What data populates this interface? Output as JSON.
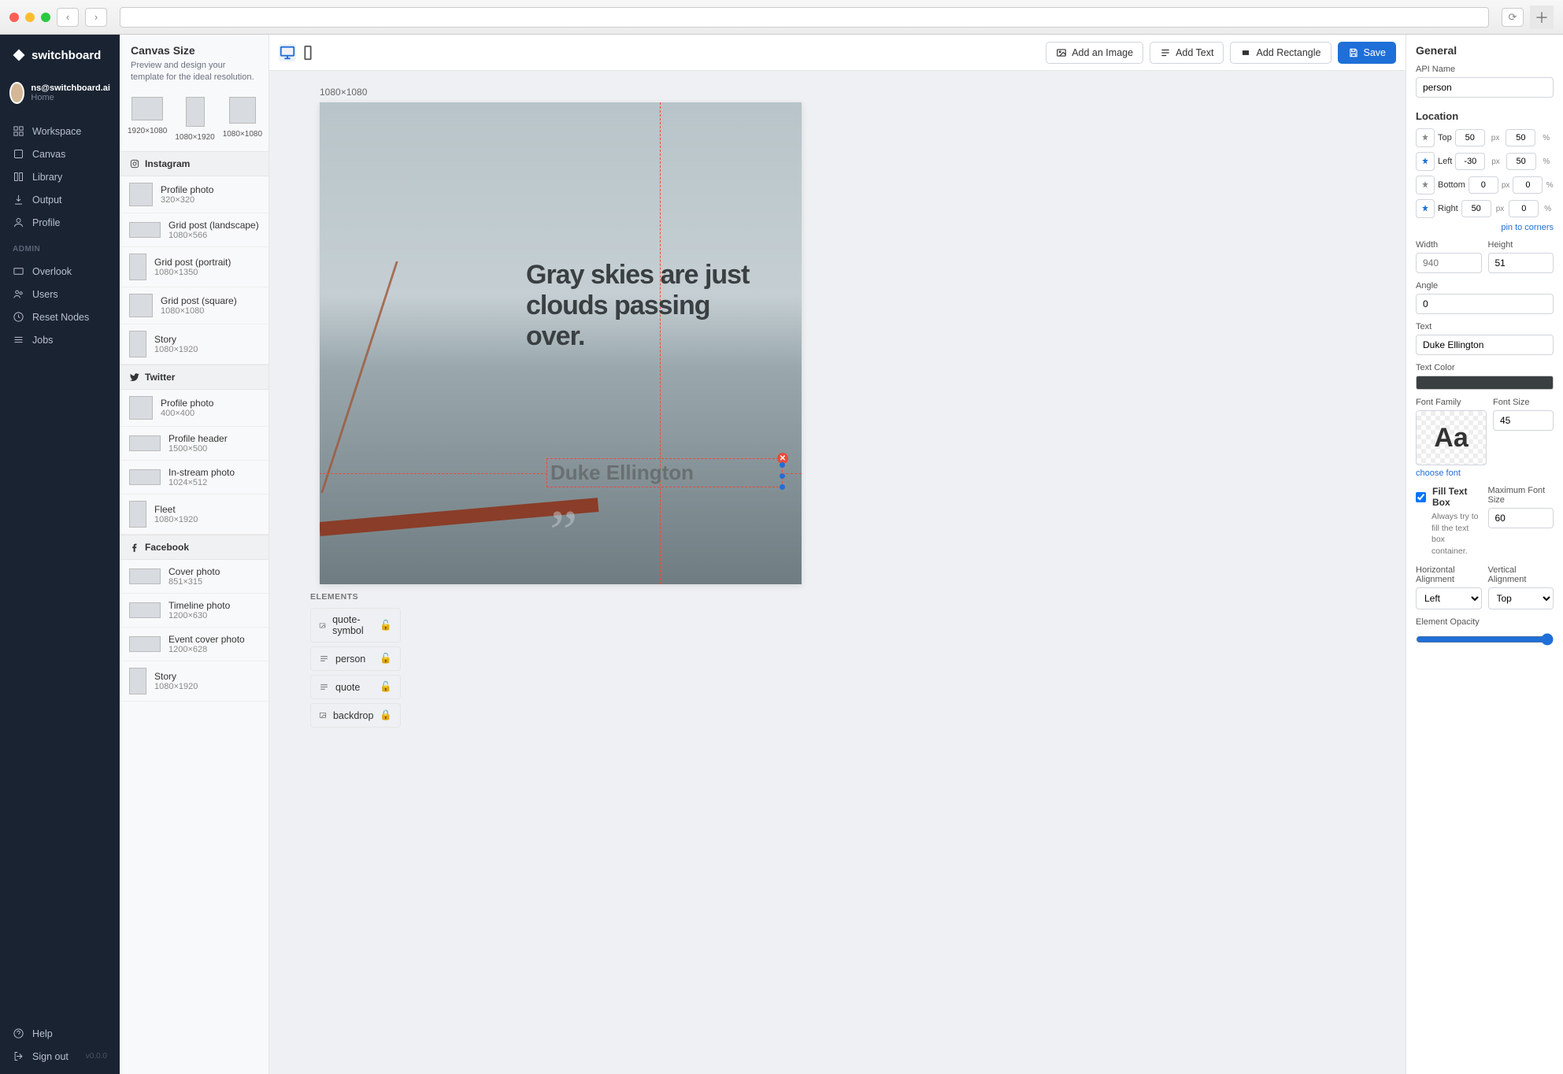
{
  "brand": "switchboard",
  "user": {
    "email": "ns@switchboard.ai",
    "home": "Home"
  },
  "nav_main": [
    {
      "label": "Workspace"
    },
    {
      "label": "Canvas"
    },
    {
      "label": "Library"
    },
    {
      "label": "Output"
    },
    {
      "label": "Profile"
    }
  ],
  "nav_admin_label": "ADMIN",
  "nav_admin": [
    {
      "label": "Overlook"
    },
    {
      "label": "Users"
    },
    {
      "label": "Reset Nodes"
    },
    {
      "label": "Jobs"
    }
  ],
  "nav_bottom": {
    "help": "Help",
    "signout": "Sign out",
    "version": "v0.0.0"
  },
  "sizepanel": {
    "title": "Canvas Size",
    "desc": "Preview and design your template for the ideal resolution.",
    "presets": [
      {
        "label": "1920×1080"
      },
      {
        "label": "1080×1920"
      },
      {
        "label": "1080×1080"
      }
    ],
    "sections": [
      {
        "name": "Instagram",
        "icon": "instagram",
        "items": [
          {
            "name": "Profile photo",
            "dim": "320×320",
            "shape": "sq"
          },
          {
            "name": "Grid post (landscape)",
            "dim": "1080×566",
            "shape": "wide"
          },
          {
            "name": "Grid post (portrait)",
            "dim": "1080×1350",
            "shape": "tall"
          },
          {
            "name": "Grid post (square)",
            "dim": "1080×1080",
            "shape": "sq"
          },
          {
            "name": "Story",
            "dim": "1080×1920",
            "shape": "tall"
          }
        ]
      },
      {
        "name": "Twitter",
        "icon": "twitter",
        "items": [
          {
            "name": "Profile photo",
            "dim": "400×400",
            "shape": "sq"
          },
          {
            "name": "Profile header",
            "dim": "1500×500",
            "shape": "wide"
          },
          {
            "name": "In-stream photo",
            "dim": "1024×512",
            "shape": "wide"
          },
          {
            "name": "Fleet",
            "dim": "1080×1920",
            "shape": "tall"
          }
        ]
      },
      {
        "name": "Facebook",
        "icon": "facebook",
        "items": [
          {
            "name": "Cover photo",
            "dim": "851×315",
            "shape": "wide"
          },
          {
            "name": "Timeline photo",
            "dim": "1200×630",
            "shape": "wide"
          },
          {
            "name": "Event cover photo",
            "dim": "1200×628",
            "shape": "wide"
          },
          {
            "name": "Story",
            "dim": "1080×1920",
            "shape": "tall"
          }
        ]
      }
    ]
  },
  "toolbar": {
    "add_image": "Add an Image",
    "add_text": "Add Text",
    "add_rect": "Add Rectangle",
    "save": "Save"
  },
  "canvas": {
    "dim_label": "1080×1080",
    "quote": "Gray skies are just clouds passing over.",
    "author": "Duke Ellington"
  },
  "elements": {
    "title": "ELEMENTS",
    "items": [
      {
        "name": "quote-symbol",
        "icon": "image",
        "locked": false
      },
      {
        "name": "person",
        "icon": "text",
        "locked": false
      },
      {
        "name": "quote",
        "icon": "text",
        "locked": false
      },
      {
        "name": "backdrop",
        "icon": "image",
        "locked": true
      }
    ]
  },
  "props": {
    "general": "General",
    "api_name_label": "API Name",
    "api_name": "person",
    "location": "Location",
    "top": {
      "v": "50",
      "u": "px",
      "v2": "50",
      "u2": "%",
      "pin": false
    },
    "left": {
      "v": "-30",
      "u": "px",
      "v2": "50",
      "u2": "%",
      "pin": true
    },
    "bottom": {
      "v": "0",
      "u": "px",
      "v2": "0",
      "u2": "%",
      "pin": false
    },
    "right": {
      "v": "50",
      "u": "px",
      "v2": "0",
      "u2": "%",
      "pin": true
    },
    "pin_corners": "pin to corners",
    "width_label": "Width",
    "width": "940",
    "height_label": "Height",
    "height": "51",
    "angle_label": "Angle",
    "angle": "0",
    "text_label": "Text",
    "text": "Duke Ellington",
    "text_color_label": "Text Color",
    "font_family_label": "Font Family",
    "font_size_label": "Font Size",
    "font_size": "45",
    "choose_font": "choose font",
    "fill_label": "Fill Text Box",
    "fill_help": "Always try to fill the text box container.",
    "max_font_label": "Maximum Font Size",
    "max_font": "60",
    "halign_label": "Horizontal Alignment",
    "halign": "Left",
    "valign_label": "Vertical Alignment",
    "valign": "Top",
    "opacity_label": "Element Opacity",
    "opacity": 100
  },
  "loc_labels": {
    "top": "Top",
    "left": "Left",
    "bottom": "Bottom",
    "right": "Right"
  }
}
